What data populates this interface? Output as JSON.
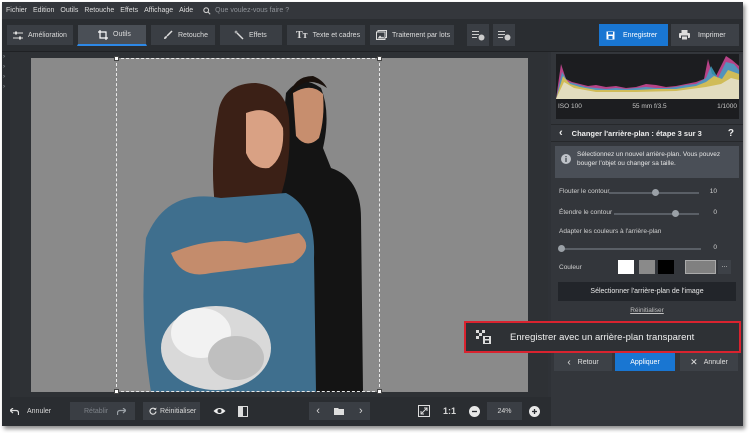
{
  "menu": {
    "items": [
      "Fichier",
      "Edition",
      "Outils",
      "Retouche",
      "Effets",
      "Affichage",
      "Aide"
    ],
    "search_placeholder": "Que voulez-vous faire ?"
  },
  "toolbar": {
    "tabs": [
      "Amélioration",
      "Outils",
      "Retouche",
      "Effets",
      "Texte et cadres",
      "Traitement par lots"
    ],
    "active_tab": "Outils",
    "save_label": "Enregistrer",
    "print_label": "Imprimer"
  },
  "histogram": {
    "iso": "ISO 100",
    "lens": "55 mm f/3.5",
    "shutter": "1/1000"
  },
  "panel": {
    "title": "Changer l'arrière-plan : étape 3 sur 3",
    "help": "?",
    "info_text": "Sélectionnez un nouvel arrière-plan. Vous pouvez bouger l'objet ou changer sa taille.",
    "sliders": [
      {
        "label": "Flouter le contour",
        "value": "10",
        "level": 0.52
      },
      {
        "label": "Étendre le contour",
        "value": "0",
        "level": 0.72
      },
      {
        "label": "Adapter les couleurs à l'arrière-plan",
        "value": "0",
        "level": 0.0
      }
    ],
    "color_label": "Couleur",
    "swatch_colors": [
      "#ffffff",
      "#8a8a8a",
      "#000000",
      "#808080"
    ],
    "more_label": "...",
    "select_bg_label": "Sélectionner l'arrière-plan de l'image",
    "reset_label": "Réinitialiser",
    "back_label": "Retour",
    "apply_label": "Appliquer",
    "cancel_label": "Annuler"
  },
  "callout": {
    "label": "Enregistrer avec un arrière-plan transparent",
    "border_color": "#d9232f"
  },
  "bottom": {
    "undo_label": "Annuler",
    "redo_label": "Rétablir",
    "reset_label": "Réinitialiser",
    "ratio_label": "1:1",
    "zoom": "24%"
  },
  "colors": {
    "accent": "#1976d2",
    "background": "#2f3237",
    "photo_background": "#8a8a8a"
  }
}
